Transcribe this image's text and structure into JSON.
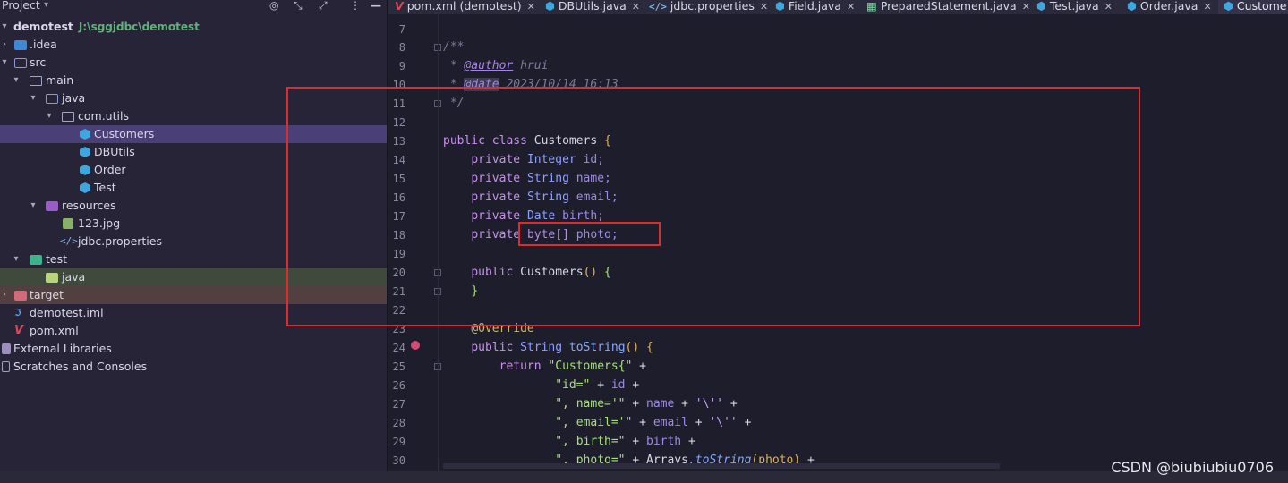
{
  "project_panel": {
    "title": "Project",
    "header_icons": [
      "target-icon",
      "expand-icon",
      "more-icon",
      "minimize-icon"
    ]
  },
  "tree": [
    {
      "label": "demotest",
      "path": "J:\\sggjdbc\\demotest",
      "icon": "module-folder-icon",
      "depth": 0,
      "expanded": true
    },
    {
      "label": ".idea",
      "icon": "folder-icon",
      "depth": 1,
      "expanded": false
    },
    {
      "label": "src",
      "icon": "source-folder-icon",
      "depth": 1,
      "expanded": true
    },
    {
      "label": "main",
      "icon": "folder-icon",
      "depth": 2,
      "expanded": true
    },
    {
      "label": "java",
      "icon": "source-folder-icon",
      "depth": 3,
      "expanded": true
    },
    {
      "label": "com.utils",
      "icon": "package-icon",
      "depth": 4,
      "expanded": true
    },
    {
      "label": "Customers",
      "icon": "class-icon",
      "depth": 5,
      "selected": true
    },
    {
      "label": "DBUtils",
      "icon": "class-icon",
      "depth": 5
    },
    {
      "label": "Order",
      "icon": "class-icon",
      "depth": 5
    },
    {
      "label": "Test",
      "icon": "class-icon",
      "depth": 5
    },
    {
      "label": "resources",
      "icon": "resources-folder-icon",
      "depth": 3,
      "expanded": true
    },
    {
      "label": "123.jpg",
      "icon": "image-file-icon",
      "depth": 4
    },
    {
      "label": "jdbc.properties",
      "icon": "properties-file-icon",
      "depth": 4
    },
    {
      "label": "test",
      "icon": "test-folder-icon",
      "depth": 2,
      "expanded": true
    },
    {
      "label": "java",
      "icon": "test-source-folder-icon",
      "depth": 3
    },
    {
      "label": "target",
      "icon": "excluded-folder-icon",
      "depth": 1,
      "expanded": false
    },
    {
      "label": "demotest.iml",
      "icon": "iml-file-icon",
      "depth": 1
    },
    {
      "label": "pom.xml",
      "icon": "maven-file-icon",
      "depth": 1
    },
    {
      "label": "External Libraries",
      "icon": "library-icon",
      "depth": 0
    },
    {
      "label": "Scratches and Consoles",
      "icon": "scratch-icon",
      "depth": 0
    }
  ],
  "tabs": [
    {
      "label": "pom.xml (demotest)",
      "icon": "maven-file-icon",
      "close": "✕"
    },
    {
      "label": "DBUtils.java",
      "icon": "class-icon",
      "close": "✕"
    },
    {
      "label": "jdbc.properties",
      "icon": "properties-file-icon",
      "close": "✕"
    },
    {
      "label": "Field.java",
      "icon": "class-icon",
      "close": "✕"
    },
    {
      "label": "PreparedStatement.java",
      "icon": "interface-icon",
      "close": "✕"
    },
    {
      "label": "Test.java",
      "icon": "class-icon",
      "close": "✕"
    },
    {
      "label": "Order.java",
      "icon": "class-icon",
      "close": "✕"
    },
    {
      "label": "Custome",
      "icon": "class-icon",
      "active": true
    }
  ],
  "editor": {
    "line_numbers": [
      "7",
      "8",
      "9",
      "10",
      "11",
      "12",
      "13",
      "14",
      "15",
      "16",
      "17",
      "18",
      "19",
      "20",
      "21",
      "22",
      "23",
      "24",
      "25",
      "26",
      "27",
      "28",
      "29",
      "30"
    ],
    "lines": {
      "l8": "/**",
      "l9_a": " * ",
      "l9_tag": "@author",
      "l9_b": " hrui",
      "l10_a": " * ",
      "l10_tag": "@date",
      "l10_b": " 2023/10/14 16:13",
      "l11": " */",
      "l13_kw1": "public",
      "l13_kw2": "class",
      "l13_name": "Customers",
      "l13_brace": "{",
      "l14_kw": "private",
      "l14_type": "Integer",
      "l14_field": "id;",
      "l15_kw": "private",
      "l15_type": "String",
      "l15_field": "name;",
      "l16_kw": "private",
      "l16_type": "String",
      "l16_field": "email;",
      "l17_kw": "private",
      "l17_type": "Date",
      "l17_field": "birth;",
      "l18_kw": "private",
      "l18_type": "byte[]",
      "l18_field": "photo;",
      "l20_kw": "public",
      "l20_name": "Customers",
      "l20_paren": "()",
      "l20_brace": "{",
      "l21": "}",
      "l23": "@Override",
      "l24_kw": "public",
      "l24_type": "String",
      "l24_name": "toString",
      "l24_paren": "()",
      "l24_brace": "{",
      "l25_kw": "return",
      "l25_str": "\"Customers{\"",
      "l25_op": " +",
      "l26_str": "\"id=\"",
      "l26_op": " + ",
      "l26_field": "id",
      "l26_op2": " +",
      "l27_str": "\", name='\"",
      "l27_op": " + ",
      "l27_field": "name",
      "l27_op2": " + ",
      "l27_ch": "'\\''",
      "l27_op3": " +",
      "l28_str": "\", email='\"",
      "l28_op": " + ",
      "l28_field": "email",
      "l28_op2": " + ",
      "l28_ch": "'\\''",
      "l28_op3": " +",
      "l29_str": "\", birth=\"",
      "l29_op": " + ",
      "l29_field": "birth",
      "l29_op2": " +",
      "l30_str": "\", photo=\"",
      "l30_op": " + ",
      "l30_cls": "Arrays",
      "l30_fn": ".toString",
      "l30_arg": "(photo)",
      "l30_op2": " +"
    }
  },
  "watermark": "CSDN @biubiubiu0706",
  "colors": {
    "highlight": "#e12b2b",
    "selection": "#4a3f76"
  }
}
